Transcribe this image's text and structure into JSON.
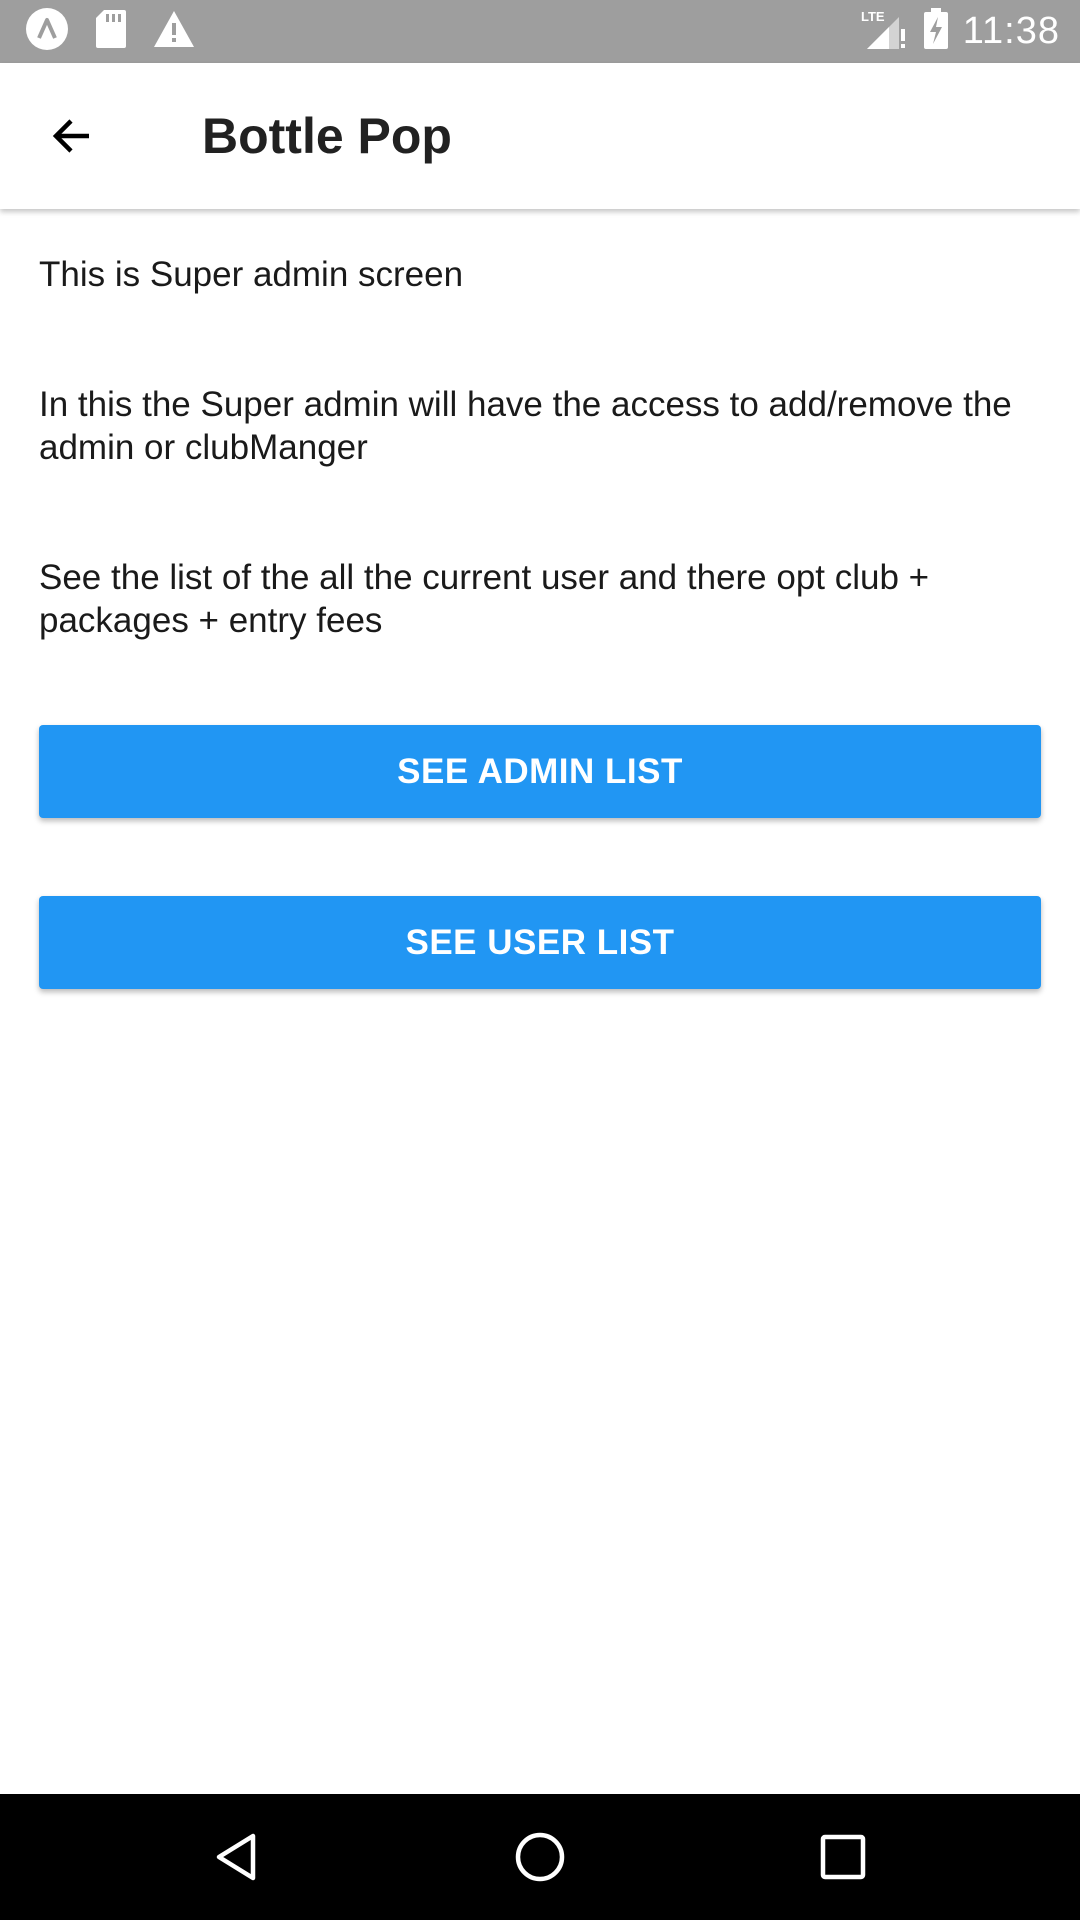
{
  "status_bar": {
    "time": "11:38",
    "icons": [
      "app-notification-icon",
      "sd-card-icon",
      "warning-icon",
      "lte-signal-icon",
      "battery-charging-icon"
    ],
    "network_label": "LTE"
  },
  "app_bar": {
    "title": "Bottle Pop",
    "back_icon": "arrow-back-icon"
  },
  "main": {
    "paragraphs": [
      "This is Super admin screen",
      "In this the Super admin will have the access to add/remove the admin or clubManger",
      "See the list of the all the current user and there opt club + packages + entry fees"
    ],
    "buttons": {
      "admin_list": "SEE ADMIN LIST",
      "user_list": "SEE USER LIST"
    }
  },
  "nav_bar": {
    "icons": [
      "nav-back-icon",
      "nav-home-icon",
      "nav-recents-icon"
    ]
  },
  "colors": {
    "status_bar": "#9e9e9e",
    "primary_button": "#2196f3",
    "button_text": "#ffffff",
    "nav_bar": "#000000",
    "text": "#1a1a1a"
  }
}
